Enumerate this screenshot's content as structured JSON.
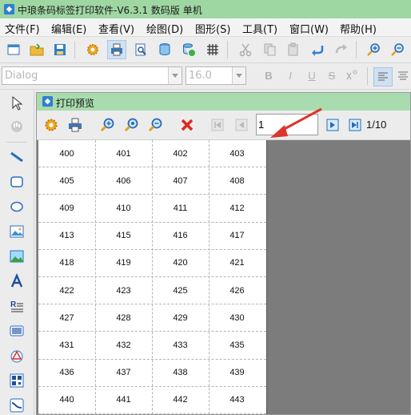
{
  "window": {
    "title": "中琅条码标签打印软件-V6.3.1 数码版 单机"
  },
  "menu": [
    "文件(F)",
    "编辑(E)",
    "查看(V)",
    "绘图(D)",
    "图形(S)",
    "工具(T)",
    "窗口(W)",
    "帮助(H)"
  ],
  "format_toolbar": {
    "font_name": "Dialog",
    "font_size": "16.0",
    "bold": "B",
    "italic": "I",
    "underline": "U",
    "strike": "S"
  },
  "preview": {
    "title": "打印预览",
    "page_input_value": "1",
    "page_count": "1/10"
  },
  "labels": [
    [
      "400",
      "401",
      "402",
      "403"
    ],
    [
      "405",
      "406",
      "407",
      "408"
    ],
    [
      "409",
      "410",
      "411",
      "412"
    ],
    [
      "413",
      "415",
      "416",
      "417"
    ],
    [
      "418",
      "419",
      "420",
      "421"
    ],
    [
      "422",
      "423",
      "425",
      "426"
    ],
    [
      "427",
      "428",
      "429",
      "430"
    ],
    [
      "431",
      "432",
      "433",
      "435"
    ],
    [
      "436",
      "437",
      "438",
      "439"
    ],
    [
      "440",
      "441",
      "442",
      "443"
    ]
  ],
  "colors": {
    "titlebar": "#9fd7a3",
    "preview_titlebar": "#a8dcae",
    "workspace": "#7c7c7c",
    "annotation_arrow": "#e0332a"
  }
}
